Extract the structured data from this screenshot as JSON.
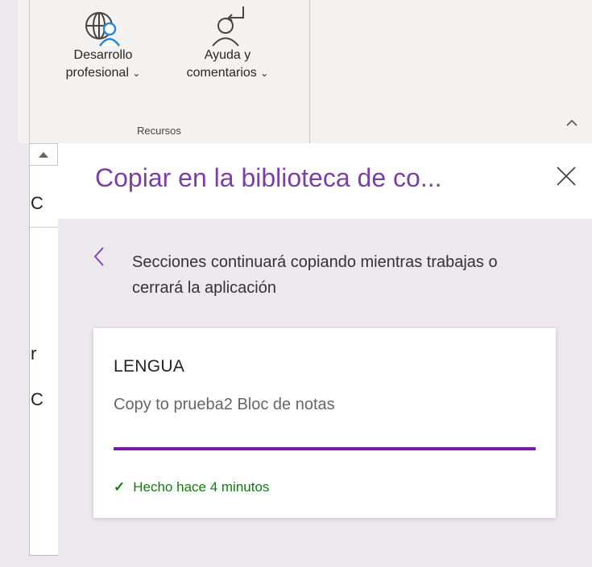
{
  "ribbon": {
    "buttons": [
      {
        "line1": "Desarrollo",
        "line2": "profesional",
        "chevron": "⌄",
        "icon": "globe-person-icon"
      },
      {
        "line1": "Ayuda y",
        "line2": "comentarios",
        "chevron": "⌄",
        "icon": "person-feedback-icon"
      }
    ],
    "group_label": "Recursos"
  },
  "document": {
    "chars": [
      "C",
      "r",
      "C"
    ]
  },
  "panel": {
    "title": "Copiar en la biblioteca de co...",
    "message": "Secciones continuará copiando mientras trabajas o cerrará la aplicación",
    "card": {
      "title": "LENGUA",
      "subtitle": "Copy to prueba2 Bloc de notas",
      "progress": 1.0,
      "status_icon": "✓",
      "status_text": "Hecho hace 4 minutos"
    }
  },
  "colors": {
    "accent": "#7a3fa8",
    "progress": "#7719aa",
    "success": "#107c10"
  }
}
